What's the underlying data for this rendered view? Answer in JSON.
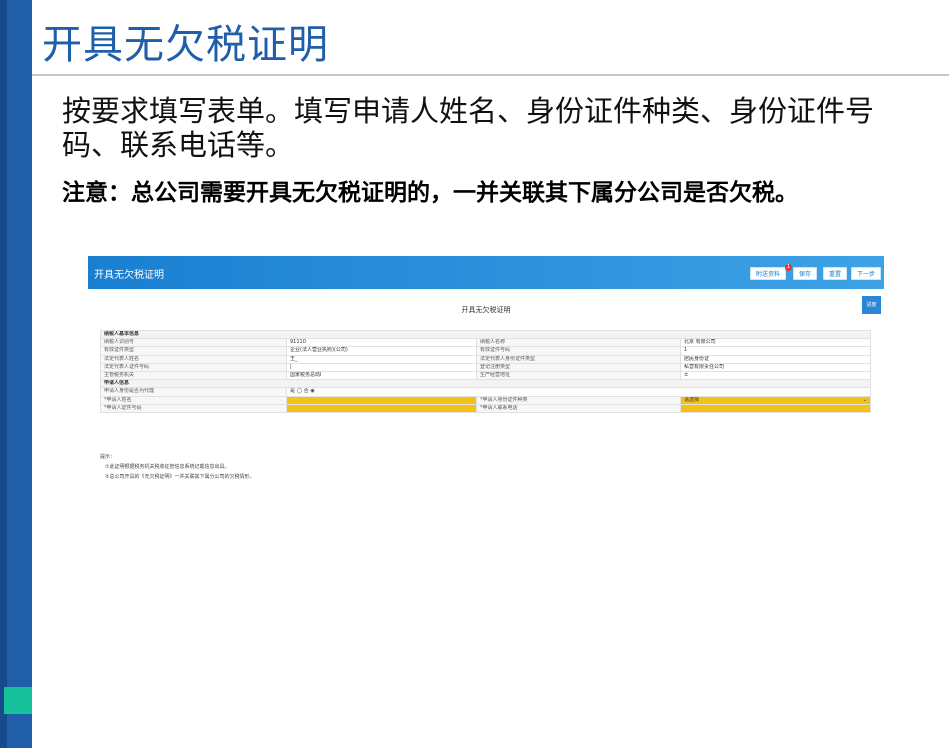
{
  "slide": {
    "title": "开具无欠税证明",
    "body": "按要求填写表单。填写申请人姓名、身份证件种类、身份证件号码、联系电话等。",
    "note": "注意：总公司需要开具无欠税证明的，一并关联其下属分公司是否欠税。",
    "accent_color": "#1f5ea8",
    "marker_color": "#17c19a"
  },
  "screenshot": {
    "header_title": "开具无欠税证明",
    "header_color": "#1a7fd1",
    "buttons": [
      "附送资料",
      "保存",
      "重置",
      "下一步"
    ],
    "badge_count": "1",
    "form_title": "开具无欠税证明",
    "side_button": "进度",
    "section_basic": "纳税人基本信息",
    "basic_rows": [
      [
        "纳税人识别号",
        "91110",
        "纳税人名称",
        "北京                        有限公司"
      ],
      [
        "有效证件类型",
        "企业(法人营业执照)(公司)",
        "有效证件号码",
        "1"
      ],
      [
        "法定代表人姓名",
        "王_",
        "法定代表人身份证件类型",
        "居民身份证"
      ],
      [
        "法定代表人证件号码",
        "|",
        "登记注册类型",
        "私营有限责任公司"
      ],
      [
        "主管税务机关",
        "国家税务总局I",
        "生产经营地址",
        "±"
      ]
    ],
    "section_applicant": "申请人信息",
    "agent_question": "申请人身份是否为代理",
    "agent_options": "是 ◯ 否 ◉",
    "applicant_name_label": "*申请人姓名",
    "applicant_id_type_label": "*申请人身份证件种类",
    "applicant_id_type_value": "请选择",
    "applicant_id_no_label": "*申请人证件号码",
    "applicant_phone_label": "*申请人联系电话",
    "tips_title": "提示：",
    "tips": [
      "①此证明根据税务机关税收征管信息系统记载信息出具。",
      "②总公司开具的《无欠税证明》一并关联其下属分公司的欠税情形。"
    ]
  }
}
